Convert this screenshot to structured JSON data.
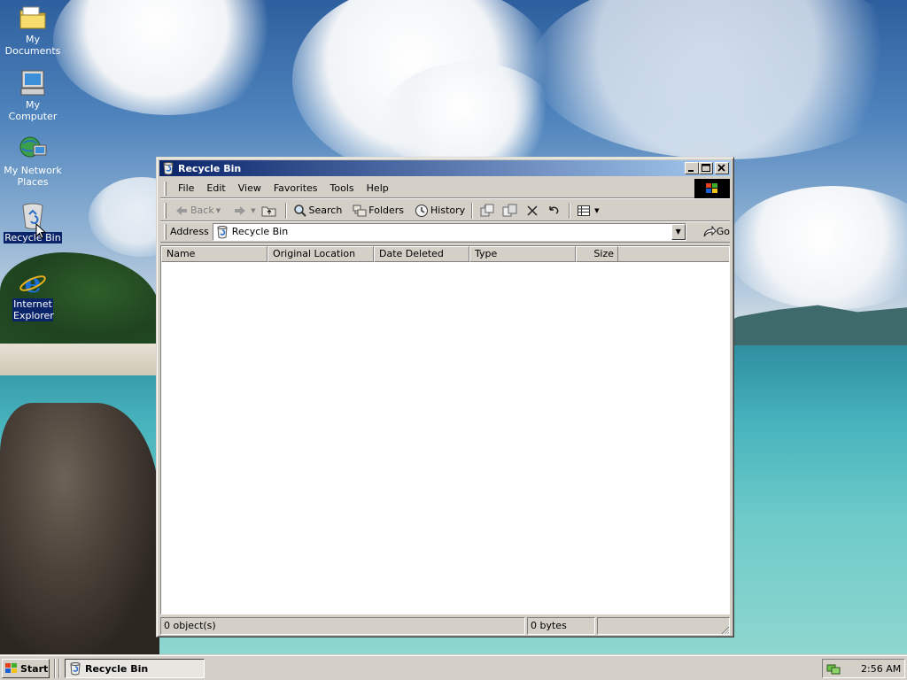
{
  "desktop": {
    "icons": [
      {
        "label": "My Documents",
        "icon": "folder-icon"
      },
      {
        "label": "My Computer",
        "icon": "computer-icon"
      },
      {
        "label": "My Network Places",
        "icon": "network-icon"
      },
      {
        "label": "Recycle Bin",
        "icon": "recycle-bin-icon"
      },
      {
        "label": "Internet Explorer",
        "icon": "internet-explorer-icon"
      }
    ]
  },
  "window": {
    "title": "Recycle Bin",
    "menu": [
      "File",
      "Edit",
      "View",
      "Favorites",
      "Tools",
      "Help"
    ],
    "toolbar": {
      "back": "Back",
      "search": "Search",
      "folders": "Folders",
      "history": "History"
    },
    "address": {
      "label": "Address",
      "value": "Recycle Bin",
      "go": "Go"
    },
    "columns": [
      "Name",
      "Original Location",
      "Date Deleted",
      "Type",
      "Size"
    ],
    "items": [],
    "status": {
      "objects": "0 object(s)",
      "size": "0 bytes"
    }
  },
  "taskbar": {
    "start": "Start",
    "task": "Recycle Bin",
    "clock": "2:56 AM"
  },
  "colors": {
    "title_active_start": "#0a246a",
    "title_active_end": "#a6caf0",
    "face": "#d4d0c8",
    "selection": "#0a246a"
  }
}
